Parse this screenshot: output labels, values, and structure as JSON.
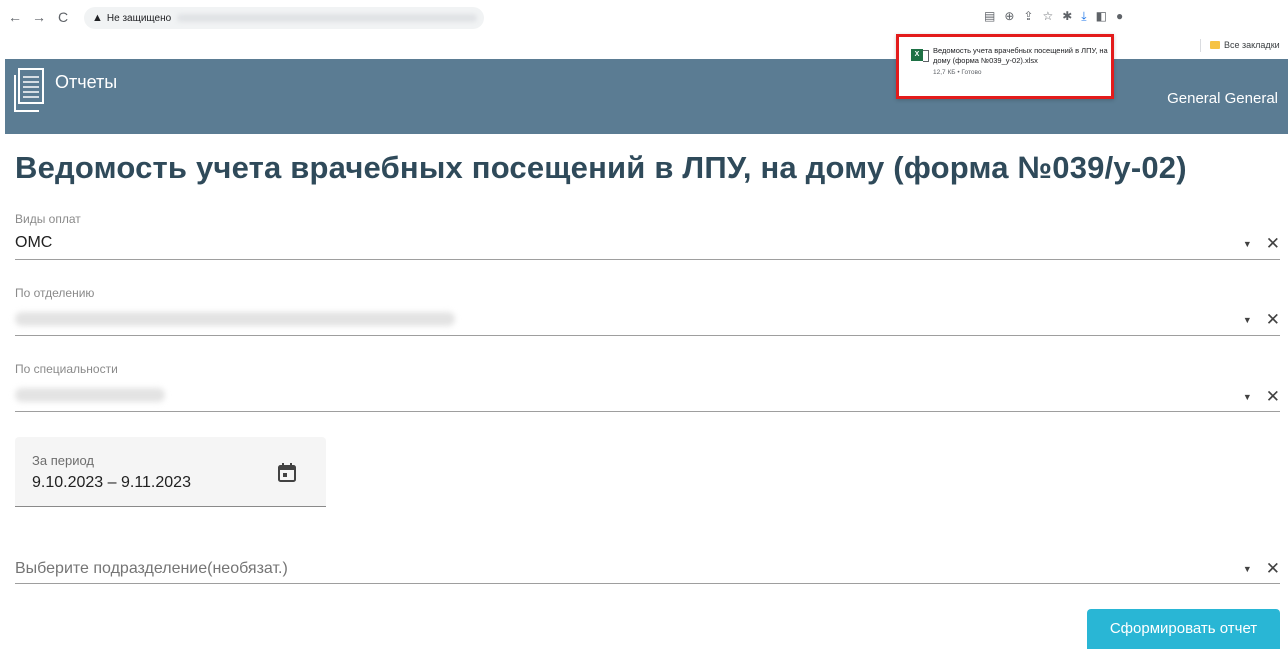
{
  "browser": {
    "nav": {
      "back": "←",
      "forward": "→",
      "reload": "C"
    },
    "security_label": "Не защищено",
    "toolbar_icons": [
      "translate-icon",
      "zoom-icon",
      "share-icon",
      "star-icon",
      "extensions-icon",
      "download-icon",
      "sidebar-icon",
      "profile-icon"
    ],
    "bookmarks_label": "Все закладки"
  },
  "download_popup": {
    "file_name": "Ведомость учета врачебных посещений в ЛПУ, на дому (форма №039_у-02).xlsx",
    "file_meta": "12,7 КБ • Готово",
    "file_icon": "X"
  },
  "app": {
    "title": "Отчеты",
    "user_name": "General General",
    "header_color": "#5b7c93"
  },
  "page": {
    "title": "Ведомость учета врачебных посещений в ЛПУ, на дому (форма №039/у-02)"
  },
  "form": {
    "payment_type": {
      "label": "Виды оплат",
      "value": "ОМС"
    },
    "department": {
      "label": "По отделению"
    },
    "specialty": {
      "label": "По специальности"
    },
    "period": {
      "label": "За период",
      "value": "9.10.2023 – 9.11.2023"
    },
    "subdivision": {
      "placeholder": "Выберите подразделение(необязат.)"
    },
    "dropdown_arrow": "▼",
    "clear_symbol": "✕",
    "submit_label": "Сформировать отчет",
    "submit_color": "#29b6d5"
  }
}
